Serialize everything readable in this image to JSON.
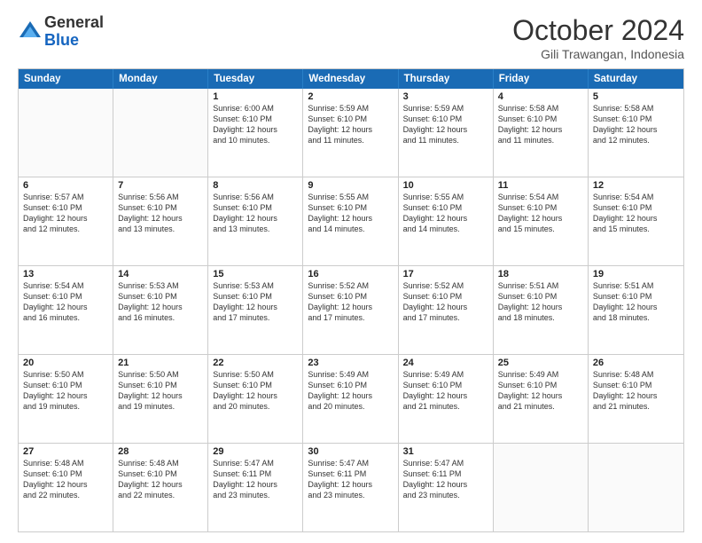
{
  "logo": {
    "line1": "General",
    "line2": "Blue"
  },
  "header": {
    "month": "October 2024",
    "location": "Gili Trawangan, Indonesia"
  },
  "days_of_week": [
    "Sunday",
    "Monday",
    "Tuesday",
    "Wednesday",
    "Thursday",
    "Friday",
    "Saturday"
  ],
  "weeks": [
    [
      {
        "day": "",
        "info": ""
      },
      {
        "day": "",
        "info": ""
      },
      {
        "day": "1",
        "info": "Sunrise: 6:00 AM\nSunset: 6:10 PM\nDaylight: 12 hours\nand 10 minutes."
      },
      {
        "day": "2",
        "info": "Sunrise: 5:59 AM\nSunset: 6:10 PM\nDaylight: 12 hours\nand 11 minutes."
      },
      {
        "day": "3",
        "info": "Sunrise: 5:59 AM\nSunset: 6:10 PM\nDaylight: 12 hours\nand 11 minutes."
      },
      {
        "day": "4",
        "info": "Sunrise: 5:58 AM\nSunset: 6:10 PM\nDaylight: 12 hours\nand 11 minutes."
      },
      {
        "day": "5",
        "info": "Sunrise: 5:58 AM\nSunset: 6:10 PM\nDaylight: 12 hours\nand 12 minutes."
      }
    ],
    [
      {
        "day": "6",
        "info": "Sunrise: 5:57 AM\nSunset: 6:10 PM\nDaylight: 12 hours\nand 12 minutes."
      },
      {
        "day": "7",
        "info": "Sunrise: 5:56 AM\nSunset: 6:10 PM\nDaylight: 12 hours\nand 13 minutes."
      },
      {
        "day": "8",
        "info": "Sunrise: 5:56 AM\nSunset: 6:10 PM\nDaylight: 12 hours\nand 13 minutes."
      },
      {
        "day": "9",
        "info": "Sunrise: 5:55 AM\nSunset: 6:10 PM\nDaylight: 12 hours\nand 14 minutes."
      },
      {
        "day": "10",
        "info": "Sunrise: 5:55 AM\nSunset: 6:10 PM\nDaylight: 12 hours\nand 14 minutes."
      },
      {
        "day": "11",
        "info": "Sunrise: 5:54 AM\nSunset: 6:10 PM\nDaylight: 12 hours\nand 15 minutes."
      },
      {
        "day": "12",
        "info": "Sunrise: 5:54 AM\nSunset: 6:10 PM\nDaylight: 12 hours\nand 15 minutes."
      }
    ],
    [
      {
        "day": "13",
        "info": "Sunrise: 5:54 AM\nSunset: 6:10 PM\nDaylight: 12 hours\nand 16 minutes."
      },
      {
        "day": "14",
        "info": "Sunrise: 5:53 AM\nSunset: 6:10 PM\nDaylight: 12 hours\nand 16 minutes."
      },
      {
        "day": "15",
        "info": "Sunrise: 5:53 AM\nSunset: 6:10 PM\nDaylight: 12 hours\nand 17 minutes."
      },
      {
        "day": "16",
        "info": "Sunrise: 5:52 AM\nSunset: 6:10 PM\nDaylight: 12 hours\nand 17 minutes."
      },
      {
        "day": "17",
        "info": "Sunrise: 5:52 AM\nSunset: 6:10 PM\nDaylight: 12 hours\nand 17 minutes."
      },
      {
        "day": "18",
        "info": "Sunrise: 5:51 AM\nSunset: 6:10 PM\nDaylight: 12 hours\nand 18 minutes."
      },
      {
        "day": "19",
        "info": "Sunrise: 5:51 AM\nSunset: 6:10 PM\nDaylight: 12 hours\nand 18 minutes."
      }
    ],
    [
      {
        "day": "20",
        "info": "Sunrise: 5:50 AM\nSunset: 6:10 PM\nDaylight: 12 hours\nand 19 minutes."
      },
      {
        "day": "21",
        "info": "Sunrise: 5:50 AM\nSunset: 6:10 PM\nDaylight: 12 hours\nand 19 minutes."
      },
      {
        "day": "22",
        "info": "Sunrise: 5:50 AM\nSunset: 6:10 PM\nDaylight: 12 hours\nand 20 minutes."
      },
      {
        "day": "23",
        "info": "Sunrise: 5:49 AM\nSunset: 6:10 PM\nDaylight: 12 hours\nand 20 minutes."
      },
      {
        "day": "24",
        "info": "Sunrise: 5:49 AM\nSunset: 6:10 PM\nDaylight: 12 hours\nand 21 minutes."
      },
      {
        "day": "25",
        "info": "Sunrise: 5:49 AM\nSunset: 6:10 PM\nDaylight: 12 hours\nand 21 minutes."
      },
      {
        "day": "26",
        "info": "Sunrise: 5:48 AM\nSunset: 6:10 PM\nDaylight: 12 hours\nand 21 minutes."
      }
    ],
    [
      {
        "day": "27",
        "info": "Sunrise: 5:48 AM\nSunset: 6:10 PM\nDaylight: 12 hours\nand 22 minutes."
      },
      {
        "day": "28",
        "info": "Sunrise: 5:48 AM\nSunset: 6:10 PM\nDaylight: 12 hours\nand 22 minutes."
      },
      {
        "day": "29",
        "info": "Sunrise: 5:47 AM\nSunset: 6:11 PM\nDaylight: 12 hours\nand 23 minutes."
      },
      {
        "day": "30",
        "info": "Sunrise: 5:47 AM\nSunset: 6:11 PM\nDaylight: 12 hours\nand 23 minutes."
      },
      {
        "day": "31",
        "info": "Sunrise: 5:47 AM\nSunset: 6:11 PM\nDaylight: 12 hours\nand 23 minutes."
      },
      {
        "day": "",
        "info": ""
      },
      {
        "day": "",
        "info": ""
      }
    ]
  ]
}
